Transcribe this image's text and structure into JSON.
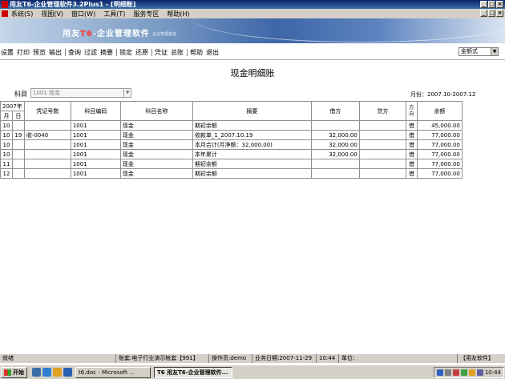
{
  "window": {
    "title": "用友T6-企业管理软件3.2Plus1  - [明细账]"
  },
  "menu": [
    "系统(S)",
    "视图(V)",
    "窗口(W)",
    "工具(T)",
    "服务专区",
    "帮助(H)"
  ],
  "banner": {
    "logo_prefix": "用友",
    "logo_t6": "T6",
    "logo_suffix": "-企业管理软件",
    "tagline": "企业管理首选"
  },
  "toolbar": {
    "groups": [
      [
        "设置",
        "打印",
        "预览",
        "输出"
      ],
      [
        "查询",
        "过滤",
        "摘要"
      ],
      [
        "锁定",
        "还原"
      ],
      [
        "凭证",
        "总账"
      ],
      [
        "帮助",
        "退出"
      ]
    ],
    "format_select": "金额式"
  },
  "page_title": "现金明细账",
  "filter": {
    "subject_label": "科目",
    "subject_value": "1001 现金",
    "month_range": "月份：2007.10-2007.12"
  },
  "table": {
    "year_header": "2007年",
    "headers": {
      "month": "月",
      "day": "日",
      "voucher_no": "凭证号数",
      "subject_code": "科目编码",
      "subject_name": "科目名称",
      "summary": "摘要",
      "debit": "借方",
      "credit": "贷方",
      "direction": "方向",
      "balance": "余额"
    },
    "rows": [
      {
        "month": "10",
        "day": "",
        "voucher": "",
        "code": "1001",
        "name": "现金",
        "summary": "期初余额",
        "debit": "",
        "credit": "",
        "dir": "借",
        "balance": "45,000.00"
      },
      {
        "month": "10",
        "day": "19",
        "voucher": "收-0040",
        "code": "1001",
        "name": "现金",
        "summary": "收款单_1_2007.10.19",
        "debit": "32,000.00",
        "credit": "",
        "dir": "借",
        "balance": "77,000.00"
      },
      {
        "month": "10",
        "day": "",
        "voucher": "",
        "code": "1001",
        "name": "现金",
        "summary": "本月合计(月净额：32,000.00)",
        "debit": "32,000.00",
        "credit": "",
        "dir": "借",
        "balance": "77,000.00"
      },
      {
        "month": "10",
        "day": "",
        "voucher": "",
        "code": "1001",
        "name": "现金",
        "summary": "本年累计",
        "debit": "32,000.00",
        "credit": "",
        "dir": "借",
        "balance": "77,000.00"
      },
      {
        "month": "11",
        "day": "",
        "voucher": "",
        "code": "1001",
        "name": "现金",
        "summary": "期初余额",
        "debit": "",
        "credit": "",
        "dir": "借",
        "balance": "77,000.00"
      },
      {
        "month": "12",
        "day": "",
        "voucher": "",
        "code": "1001",
        "name": "现金",
        "summary": "期初余额",
        "debit": "",
        "credit": "",
        "dir": "借",
        "balance": "77,000.00"
      }
    ]
  },
  "status": {
    "state": "就绪",
    "account_set": "账套:电子行业演示帐套【991】",
    "operator": "操作员:demo",
    "business_date": "业务日期:2007-11-29",
    "time": "10:44",
    "unit": "单位:",
    "brand": "【用友软件】"
  },
  "taskbar": {
    "start": "开始",
    "tasks": [
      "t6.doc - Microsoft ...",
      "T6 用友T6-企业管理软件..."
    ],
    "clock": "10:44"
  }
}
